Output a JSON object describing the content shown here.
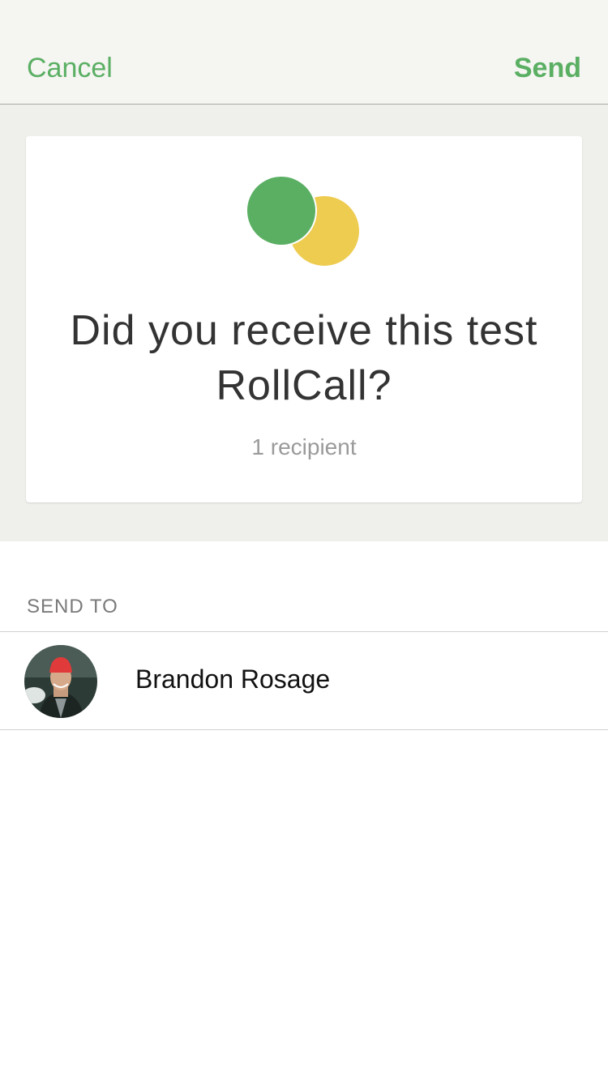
{
  "navbar": {
    "cancel_label": "Cancel",
    "send_label": "Send"
  },
  "card": {
    "title": "Did you receive this test RollCall?",
    "recipient_count": "1 recipient"
  },
  "send_to": {
    "header": "SEND TO",
    "recipients": [
      {
        "name": "Brandon Rosage"
      }
    ]
  },
  "colors": {
    "accent": "#5aaf63",
    "logo_green": "#5aaf63",
    "logo_yellow": "#eecc50"
  }
}
